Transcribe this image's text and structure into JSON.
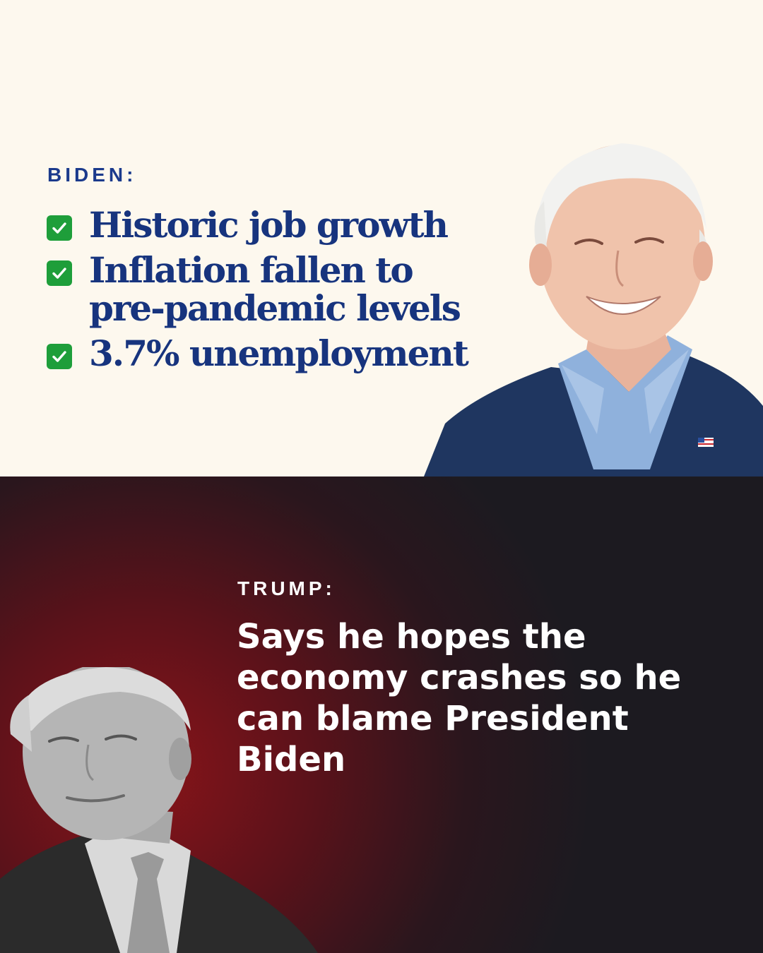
{
  "biden": {
    "label": "BIDEN:",
    "items": [
      {
        "text": "Historic job growth",
        "icon": "check-mark-icon"
      },
      {
        "text": "Inflation fallen to pre-pandemic levels",
        "icon": "check-mark-icon"
      },
      {
        "text": "3.7% unemployment",
        "icon": "check-mark-icon"
      }
    ]
  },
  "trump": {
    "label": "TRUMP:",
    "quote": "Says he hopes the economy crashes so he can blame President Biden"
  },
  "colors": {
    "top_background": "#fdf8ee",
    "biden_text": "#17347e",
    "check_green": "#1e9e3a",
    "bottom_red": "#8a1419",
    "bottom_dark": "#1c1a20"
  }
}
